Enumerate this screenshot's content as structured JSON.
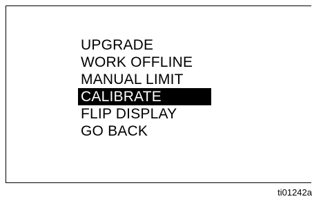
{
  "menu": {
    "items": [
      {
        "label": "UPGRADE"
      },
      {
        "label": "WORK OFFLINE"
      },
      {
        "label": "MANUAL LIMIT"
      },
      {
        "label": "CALIBRATE",
        "selected": true
      },
      {
        "label": "FLIP DISPLAY"
      },
      {
        "label": "GO BACK"
      }
    ]
  },
  "figure_id": "ti01242a"
}
